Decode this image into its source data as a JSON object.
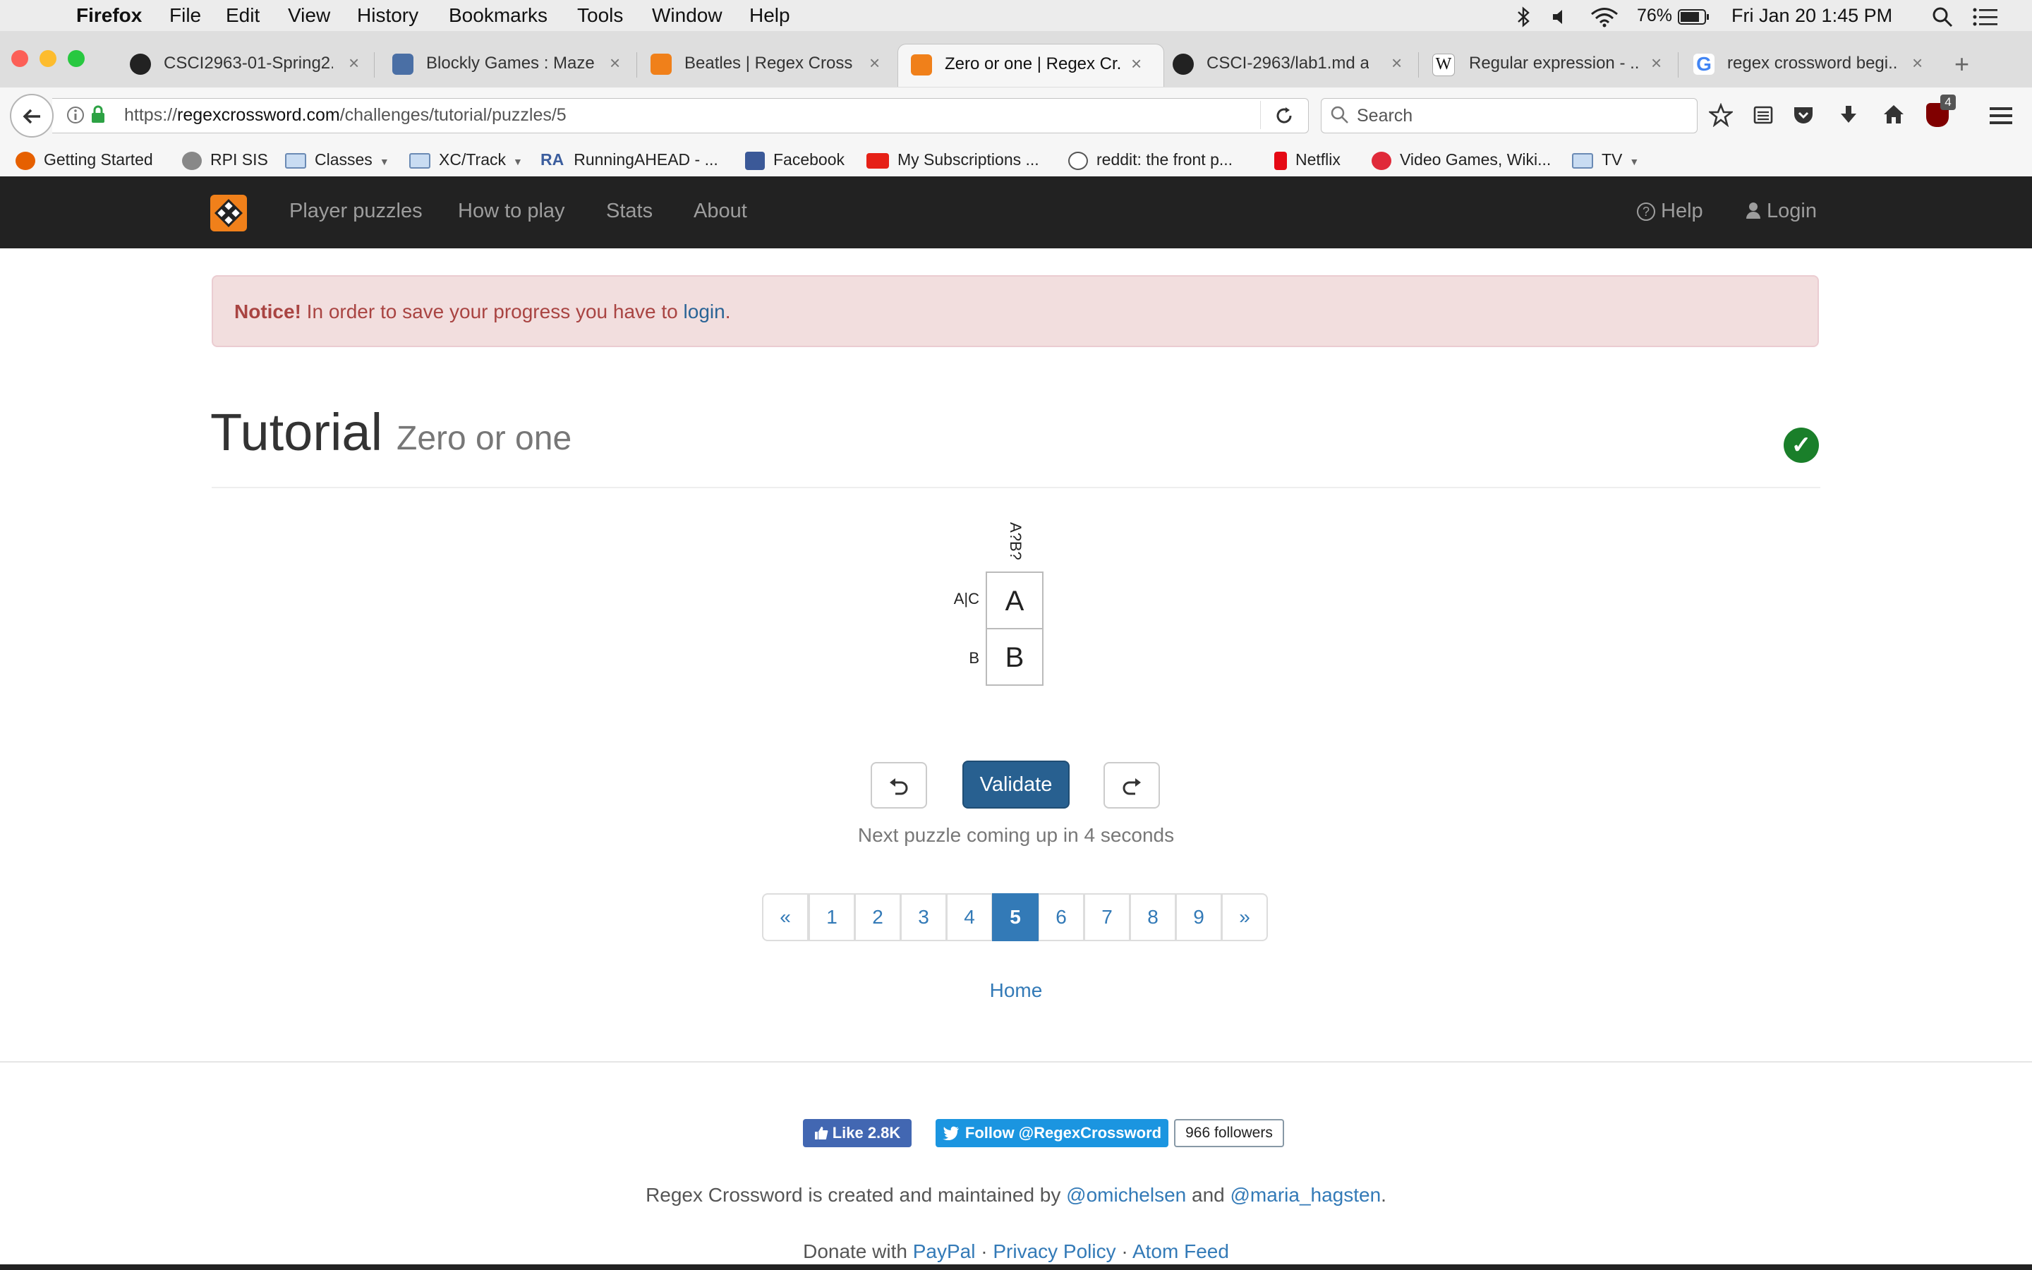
{
  "menubar": {
    "app": "Firefox",
    "items": [
      "File",
      "Edit",
      "View",
      "History",
      "Bookmarks",
      "Tools",
      "Window",
      "Help"
    ],
    "battery": "76%",
    "datetime": "Fri Jan 20  1:45 PM"
  },
  "tabs": [
    {
      "label": "CSCI2963-01-Spring2...",
      "icon": "github-icon",
      "color": "#222222"
    },
    {
      "label": "Blockly Games : Maze",
      "icon": "blockly-icon",
      "color": "#4a6fa5"
    },
    {
      "label": "Beatles | Regex Cross...",
      "icon": "regex-crossword-icon",
      "color": "#f0801a"
    },
    {
      "label": "Zero or one | Regex Cr...",
      "icon": "regex-crossword-icon",
      "color": "#f0801a",
      "active": true
    },
    {
      "label": "CSCI-2963/lab1.md at...",
      "icon": "github-icon",
      "color": "#222222"
    },
    {
      "label": "Regular expression - ...",
      "icon": "wikipedia-icon",
      "color": "#ffffff"
    },
    {
      "label": "regex crossword begi...",
      "icon": "google-icon",
      "color": "#4285f4"
    }
  ],
  "navbar": {
    "url_prefix": "https://",
    "url_host": "regexcrossword.com",
    "url_path": "/challenges/tutorial/puzzles/5",
    "search_placeholder": "Search",
    "badge": "4"
  },
  "bookmarks": [
    {
      "label": "Getting Started",
      "icon": "firefox-icon",
      "color": "#e66000"
    },
    {
      "label": "RPI SIS",
      "icon": "globe-icon",
      "color": "#888888"
    },
    {
      "label": "Classes",
      "icon": "folder-icon",
      "dropdown": true
    },
    {
      "label": "XC/Track",
      "icon": "folder-icon",
      "dropdown": true
    },
    {
      "label": "RunningAHEAD - ...",
      "icon": "runningahead-icon",
      "prefix": "RA"
    },
    {
      "label": "Facebook",
      "icon": "facebook-icon",
      "color": "#3b5998"
    },
    {
      "label": "My Subscriptions ...",
      "icon": "youtube-icon",
      "color": "#e62117"
    },
    {
      "label": "reddit: the front p...",
      "icon": "reddit-icon",
      "color": "#ffffff"
    },
    {
      "label": "Netflix",
      "icon": "netflix-icon",
      "color": "#e50914"
    },
    {
      "label": "Video Games, Wiki...",
      "icon": "fandom-icon",
      "color": "#e02a3a"
    },
    {
      "label": "TV",
      "icon": "folder-icon",
      "dropdown": true
    }
  ],
  "site": {
    "nav": [
      "Player puzzles",
      "How to play",
      "Stats",
      "About"
    ],
    "help": "Help",
    "login": "Login"
  },
  "notice": {
    "strong": "Notice!",
    "text": " In order to save your progress you have to ",
    "link": "login",
    "end": "."
  },
  "heading": {
    "title": "Tutorial",
    "subtitle": "Zero or one",
    "solved": true
  },
  "puzzle": {
    "column_clue": "A?B?",
    "row_clues": [
      "A|C",
      "B"
    ],
    "cells": [
      "A",
      "B"
    ]
  },
  "controls": {
    "undo_icon": "undo-icon",
    "validate": "Validate",
    "redo_icon": "redo-icon",
    "message": "Next puzzle coming up in 4 seconds"
  },
  "pagination": {
    "prev": "«",
    "pages": [
      "1",
      "2",
      "3",
      "4",
      "5",
      "6",
      "7",
      "8",
      "9"
    ],
    "current": "5",
    "next": "»"
  },
  "home": "Home",
  "footer": {
    "like": "Like 2.8K",
    "follow": "Follow @RegexCrossword",
    "followers": "966 followers",
    "credits_pre": "Regex Crossword is created and maintained by ",
    "author1": "@omichelsen",
    "credits_mid": " and ",
    "author2": "@maria_hagsten",
    "credits_end": ".",
    "donate_pre": "Donate with ",
    "paypal": "PayPal",
    "sep": " · ",
    "privacy": "Privacy Policy",
    "atom": "Atom Feed"
  }
}
